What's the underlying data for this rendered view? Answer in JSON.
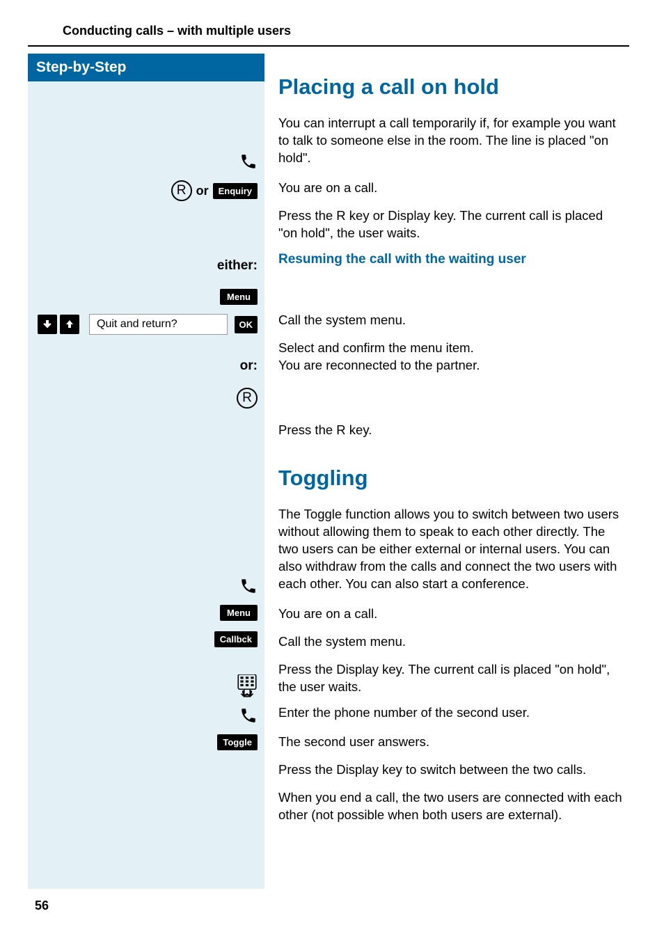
{
  "header": {
    "title": "Conducting calls – with multiple users"
  },
  "sidebar": {
    "title": "Step-by-Step"
  },
  "section1": {
    "title": "Placing a call on hold",
    "intro": "You can interrupt a call temporarily if, for example you want to talk to someone else in the room. The line is placed \"on hold\".",
    "step1": "You are on a call.",
    "step2": "Press the R key or Display key. The current call is placed \"on hold\", the user waits.",
    "subheading": "Resuming the call with the waiting user",
    "either": "either:",
    "step3": "Call the system menu.",
    "step4a": "Select and confirm the menu item.",
    "step4b": "You are reconnected to the partner.",
    "or": "or:",
    "step5": "Press the R key."
  },
  "section2": {
    "title": "Toggling",
    "intro": "The Toggle function allows you to switch between two users without allowing them to speak to each other directly. The two users can be either external or internal users. You can also withdraw from the calls and connect the two users with each other. You can also start a conference.",
    "step1": "You are on a call.",
    "step2": "Call the system menu.",
    "step3": "Press the Display key. The current call is placed \"on hold\", the user waits.",
    "step4": "Enter the phone number of the second user.",
    "step5": "The second user answers.",
    "step6": "Press the Display key to switch between the two calls.",
    "step7": "When you end a call, the two users are connected with each other (not possible when both users are external)."
  },
  "keys": {
    "r": "R",
    "or": "or",
    "enquiry": "Enquiry",
    "menu": "Menu",
    "ok": "OK",
    "callbck": "Callbck",
    "toggle": "Toggle",
    "quit_return": "Quit and return?"
  },
  "pageNumber": "56"
}
